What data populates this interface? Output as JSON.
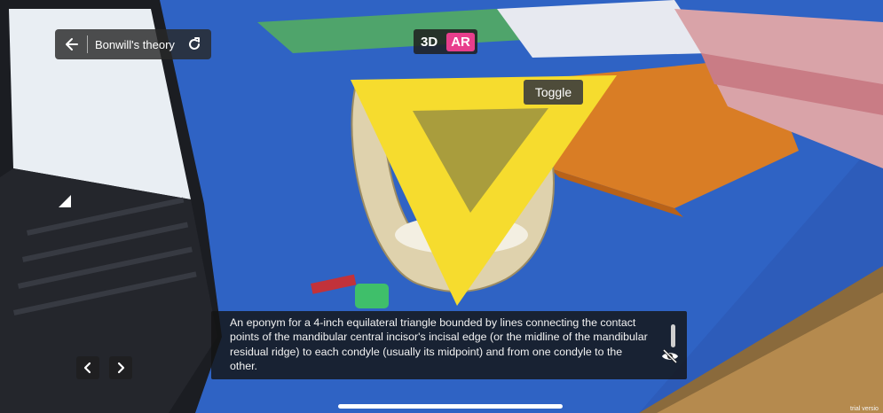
{
  "header": {
    "title": "Bonwill's theory",
    "back_icon": "arrow-left-icon",
    "reload_icon": "refresh-icon"
  },
  "mode": {
    "option_3d": "3D",
    "option_ar": "AR",
    "active": "AR",
    "ar_color": "#e83e8c"
  },
  "toggle_label": "Toggle",
  "description": {
    "text": "An eponym for a 4-inch equilateral triangle bounded by lines connecting the contact points of the mandibular central incisor's incisal edge (or the midline of the mandibular residual ridge) to each condyle (usually its midpoint) and from one condyle to the other.",
    "hide_icon": "eye-slash-icon"
  },
  "nav": {
    "prev_icon": "chevron-left-icon",
    "next_icon": "chevron-right-icon"
  },
  "watermark": "trial versio",
  "overlay_color": "#f6dc2e"
}
